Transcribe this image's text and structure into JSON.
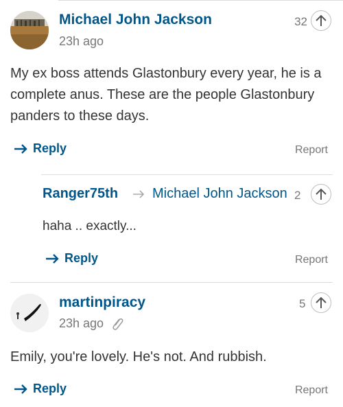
{
  "comments": [
    {
      "author": "Michael John Jackson",
      "time": "23h ago",
      "votes": "32",
      "text": "My ex boss attends Glastonbury every year, he is a complete anus. These are the people Glastonbury panders to these days.",
      "reply_label": "Reply",
      "report_label": "Report"
    },
    {
      "author": "Ranger75th",
      "reply_to": "Michael John Jackson",
      "votes": "2",
      "text": "haha .. exactly...",
      "reply_label": "Reply",
      "report_label": "Report"
    },
    {
      "author": "martinpiracy",
      "time": "23h ago",
      "votes": "5",
      "text": "Emily, you're lovely. He's not. And rubbish.",
      "reply_label": "Reply",
      "report_label": "Report"
    }
  ],
  "icons": {
    "reply": "reply-arrow-icon",
    "upvote": "arrow-up-icon",
    "edited": "paperclip-icon",
    "reply_to": "reply-to-arrow-icon"
  },
  "colors": {
    "link": "#005689",
    "muted": "#767676",
    "divider": "#dcdcdc"
  }
}
